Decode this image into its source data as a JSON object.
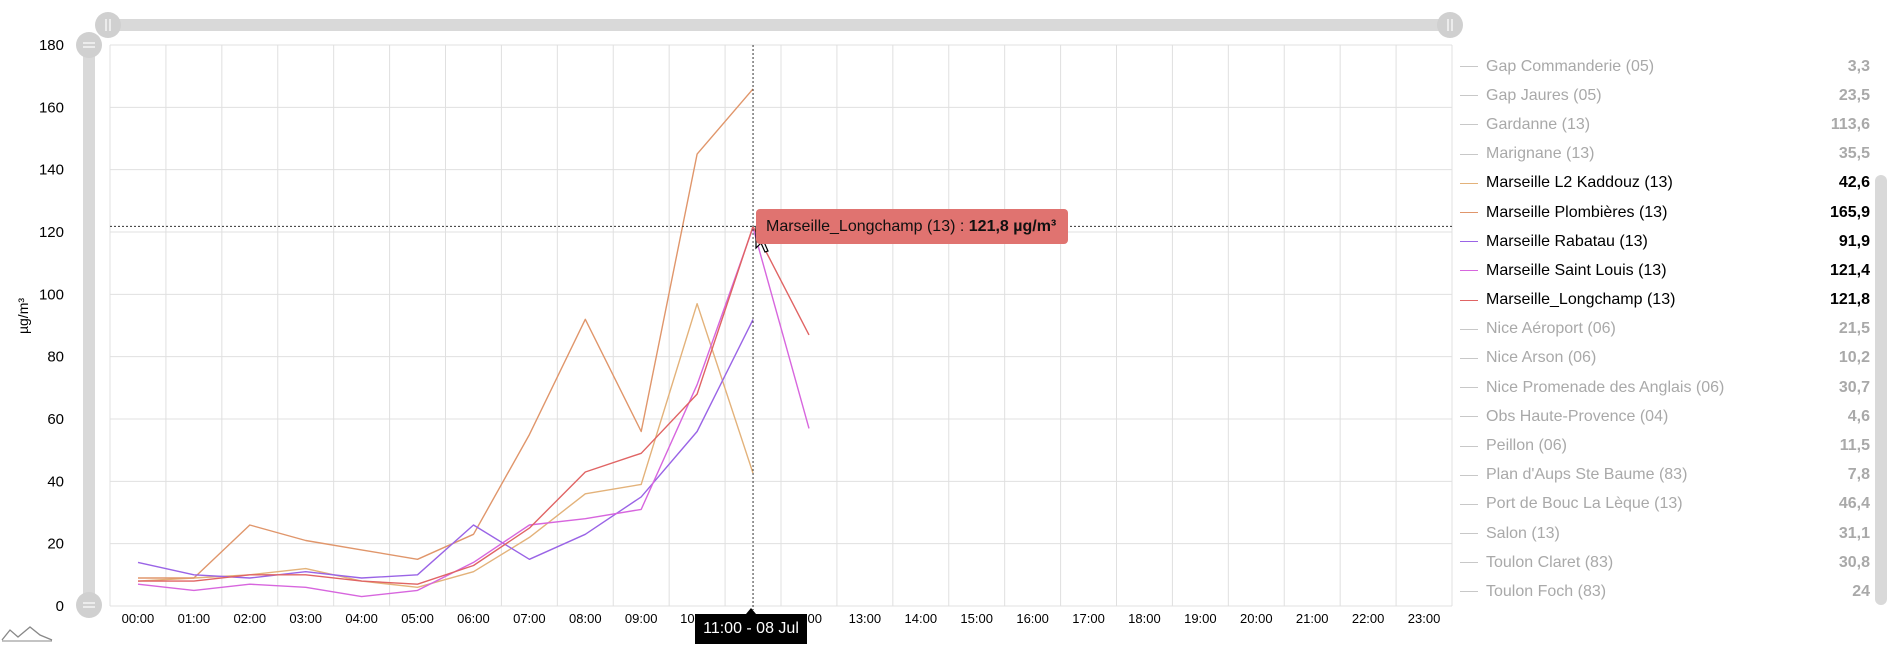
{
  "chart_data": {
    "type": "line",
    "ylabel": "µg/m³",
    "ylim": [
      0,
      180
    ],
    "yticks": [
      "0",
      "20",
      "40",
      "60",
      "80",
      "100",
      "120",
      "140",
      "160",
      "180"
    ],
    "x": [
      "00:00",
      "01:00",
      "02:00",
      "03:00",
      "04:00",
      "05:00",
      "06:00",
      "07:00",
      "08:00",
      "09:00",
      "10:00",
      "11:00",
      "12:00",
      "13:00",
      "14:00",
      "15:00",
      "16:00",
      "17:00",
      "18:00",
      "19:00",
      "20:00",
      "21:00",
      "22:00",
      "23:00"
    ],
    "xticks_visible": [
      "00:00",
      "01:00",
      "02:00",
      "03:00",
      "04:00",
      "05:00",
      "06:00",
      "07:00",
      "08:00",
      "09:00",
      "10",
      "00",
      "13:00",
      "14:00",
      "15:00",
      "16:00",
      "17:00",
      "18:00",
      "19:00",
      "20:00",
      "21:00",
      "22:00",
      "23:00"
    ],
    "grid": true,
    "legend": "right",
    "series": [
      {
        "name": "Marseille L2 Kaddouz (13)",
        "color": "#e3b27a",
        "values": [
          8,
          9,
          10,
          12,
          8,
          6,
          11,
          22,
          36,
          39,
          97,
          42.6,
          null,
          null,
          null,
          null,
          null,
          null,
          null,
          null,
          null,
          null,
          null,
          null
        ]
      },
      {
        "name": "Marseille Plombières (13)",
        "color": "#e0966b",
        "values": [
          9,
          9,
          26,
          21,
          18,
          15,
          23,
          55,
          92,
          56,
          145,
          165.9,
          null,
          null,
          null,
          null,
          null,
          null,
          null,
          null,
          null,
          null,
          null,
          null
        ]
      },
      {
        "name": "Marseille Rabatau (13)",
        "color": "#9a64e6",
        "values": [
          14,
          10,
          9,
          11,
          9,
          10,
          26,
          15,
          23,
          35,
          56,
          91.9,
          null,
          null,
          null,
          null,
          null,
          null,
          null,
          null,
          null,
          null,
          null,
          null
        ]
      },
      {
        "name": "Marseille Saint Louis (13)",
        "color": "#d766de",
        "values": [
          7,
          5,
          7,
          6,
          3,
          5,
          14,
          26,
          28,
          31,
          71,
          121.4,
          57,
          null,
          null,
          null,
          null,
          null,
          null,
          null,
          null,
          null,
          null,
          null
        ]
      },
      {
        "name": "Marseille_Longchamp (13)",
        "color": "#e06464",
        "values": [
          8,
          8,
          10,
          10,
          8,
          7,
          13,
          25,
          43,
          49,
          68,
          121.8,
          87,
          null,
          null,
          null,
          null,
          null,
          null,
          null,
          null,
          null,
          null,
          null
        ]
      }
    ]
  },
  "legend_items": [
    {
      "name": "Gap Commanderie (05)",
      "value": "3,3",
      "active": false
    },
    {
      "name": "Gap Jaures (05)",
      "value": "23,5",
      "active": false
    },
    {
      "name": "Gardanne (13)",
      "value": "113,6",
      "active": false
    },
    {
      "name": "Marignane (13)",
      "value": "35,5",
      "active": false
    },
    {
      "name": "Marseille L2 Kaddouz (13)",
      "value": "42,6",
      "active": true,
      "color": "#e3b27a"
    },
    {
      "name": "Marseille Plombières (13)",
      "value": "165,9",
      "active": true,
      "color": "#e0966b"
    },
    {
      "name": "Marseille Rabatau (13)",
      "value": "91,9",
      "active": true,
      "color": "#9a64e6"
    },
    {
      "name": "Marseille Saint Louis (13)",
      "value": "121,4",
      "active": true,
      "color": "#d766de"
    },
    {
      "name": "Marseille_Longchamp (13)",
      "value": "121,8",
      "active": true,
      "color": "#e06464"
    },
    {
      "name": "Nice Aéroport (06)",
      "value": "21,5",
      "active": false
    },
    {
      "name": "Nice Arson (06)",
      "value": "10,2",
      "active": false
    },
    {
      "name": "Nice Promenade des Anglais (06)",
      "value": "30,7",
      "active": false
    },
    {
      "name": "Obs Haute-Provence (04)",
      "value": "4,6",
      "active": false
    },
    {
      "name": "Peillon (06)",
      "value": "11,5",
      "active": false
    },
    {
      "name": "Plan d'Aups Ste Baume (83)",
      "value": "7,8",
      "active": false
    },
    {
      "name": "Port de Bouc La Lèque (13)",
      "value": "46,4",
      "active": false
    },
    {
      "name": "Salon (13)",
      "value": "31,1",
      "active": false
    },
    {
      "name": "Toulon Claret (83)",
      "value": "30,8",
      "active": false
    },
    {
      "name": "Toulon Foch (83)",
      "value": "24",
      "active": false
    }
  ],
  "tooltip": {
    "series": "Marseille_Longchamp (13) :",
    "value": "121,8 µg/m³"
  },
  "cursor": {
    "x_index": 11,
    "y_value": 121.8,
    "x_label": "11:00 - 08 Jul"
  },
  "colors": {
    "grid": "#e0e0e0",
    "scrollbar": "#d9d9d9",
    "tooltip_bg": "#e07370",
    "inactive_text": "#a9a9a9"
  },
  "icons": {
    "zoom_handle": "grip-lines-icon",
    "preview": "mountain-line-icon"
  }
}
